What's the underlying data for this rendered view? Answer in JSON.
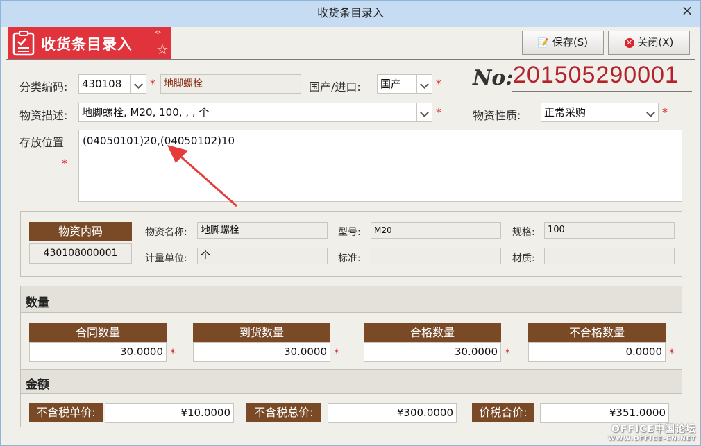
{
  "window": {
    "title": "收货条目录入"
  },
  "banner": {
    "title": "收货条目录入"
  },
  "toolbar": {
    "save_label": "保存(S)",
    "close_label": "关闭(X)"
  },
  "form": {
    "category_code_label": "分类编码:",
    "category_code_value": "430108",
    "category_name_value": "地脚螺栓",
    "origin_label": "国产/进口:",
    "origin_value": "国产",
    "no_label": "No:",
    "no_value": "201505290001",
    "material_desc_label": "物资描述:",
    "material_desc_value": "地脚螺栓, M20, 100, , , 个",
    "material_nature_label": "物资性质:",
    "material_nature_value": "正常采购",
    "storage_label": "存放位置",
    "storage_value": "(04050101)20,(04050102)10",
    "required_mark": "*"
  },
  "material_info": {
    "code_header": "物资内码",
    "code_value": "430108000001",
    "name_label": "物资名称:",
    "name_value": "地脚螺栓",
    "model_label": "型号:",
    "model_value": "M20",
    "spec_label": "规格:",
    "spec_value": "100",
    "unit_label": "计量单位:",
    "unit_value": "个",
    "standard_label": "标准:",
    "standard_value": "",
    "texture_label": "材质:",
    "texture_value": ""
  },
  "quantity": {
    "section_title": "数量",
    "contract_label": "合同数量",
    "contract_value": "30.0000",
    "arrival_label": "到货数量",
    "arrival_value": "30.0000",
    "qualified_label": "合格数量",
    "qualified_value": "30.0000",
    "unqualified_label": "不合格数量",
    "unqualified_value": "0.0000"
  },
  "amount": {
    "section_title": "金额",
    "unit_price_label": "不含税单价:",
    "unit_price_value": "¥10.0000",
    "total_price_label": "不含税总价:",
    "total_price_value": "¥300.0000",
    "tax_total_label": "价税合价:",
    "tax_total_value": "¥351.0000"
  },
  "watermark": {
    "line1": "OFFICE中国论坛",
    "line2": "WWW.OFFICE-CN.NET"
  },
  "colors": {
    "banner": "#e0333c",
    "header_brown": "#7a4a26",
    "required": "#d9232d",
    "no_number": "#b3232a",
    "titlebar": "#c6dcf2"
  }
}
